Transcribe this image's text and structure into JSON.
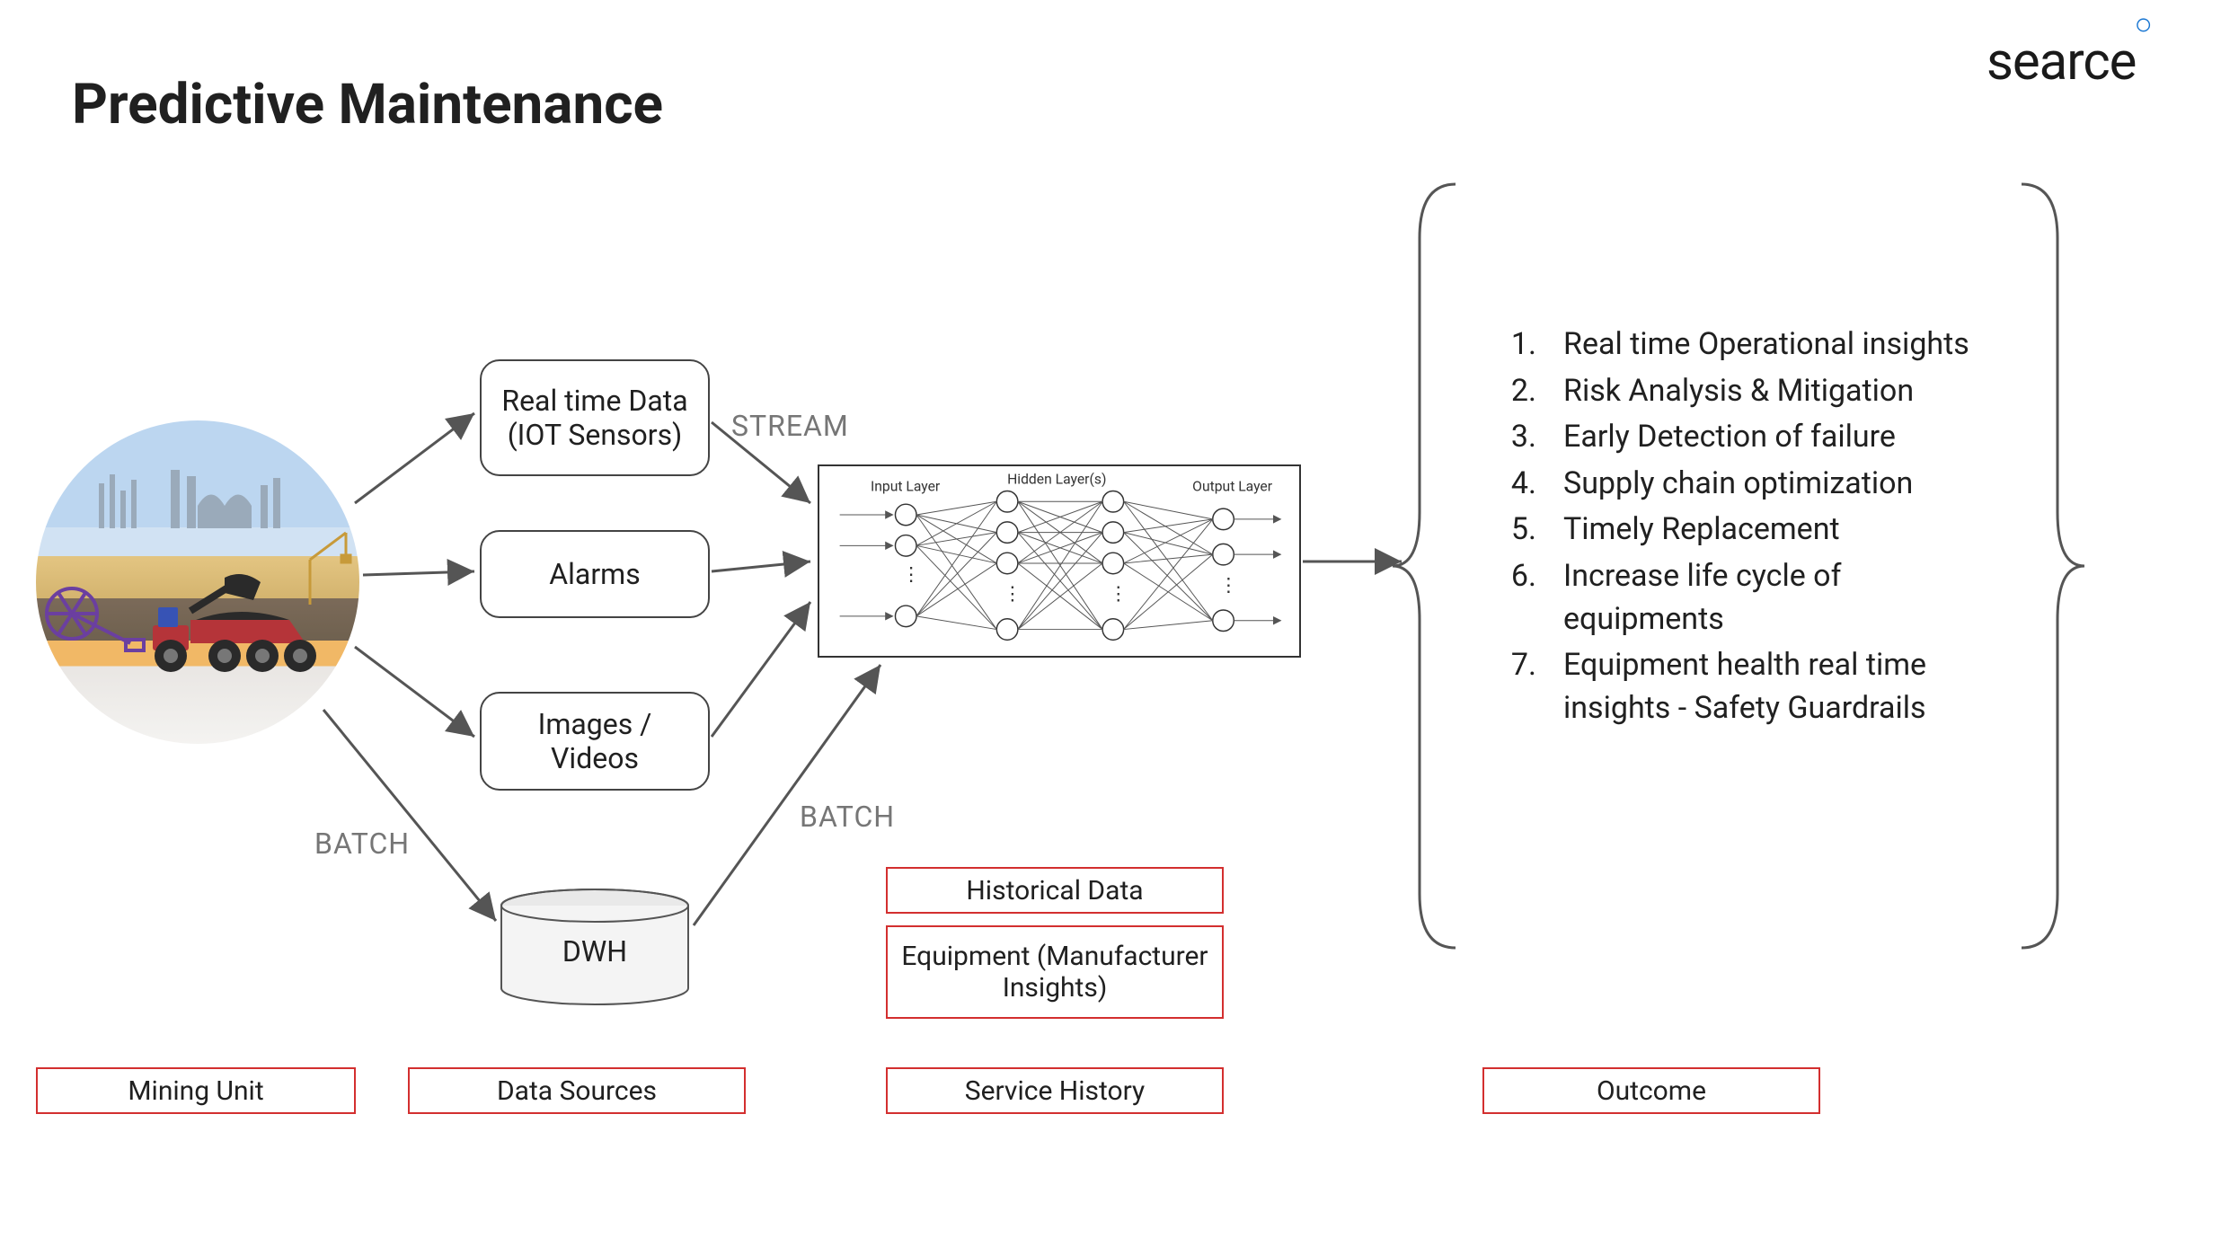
{
  "title": "Predictive Maintenance",
  "brand": "searce",
  "data_sources": {
    "iot": "Real time Data (IOT Sensors)",
    "alarms": "Alarms",
    "images": "Images / Videos",
    "dwh": "DWH"
  },
  "flow_labels": {
    "stream": "STREAM",
    "batch1": "BATCH",
    "batch2": "BATCH"
  },
  "nn_labels": {
    "input": "Input Layer",
    "hidden": "Hidden Layer(s)",
    "output": "Output Layer"
  },
  "red_boxes": {
    "historical": "Historical Data",
    "equipment_mfr": "Equipment (Manufacturer Insights)",
    "service_history": "Service History",
    "mining_unit": "Mining Unit",
    "data_sources": "Data Sources",
    "outcome": "Outcome"
  },
  "outcomes": [
    "Real time Operational insights",
    "Risk Analysis & Mitigation",
    "Early Detection of failure",
    "Supply chain optimization",
    "Timely Replacement",
    "Increase life cycle of equipments",
    "Equipment health real time insights - Safety Guardrails"
  ]
}
